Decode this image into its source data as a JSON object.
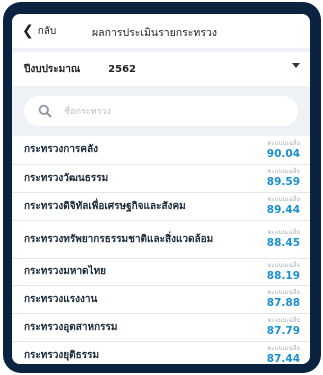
{
  "header": {
    "back_label": "กลับ",
    "title": "ผลการประเมินรายกระทรวง"
  },
  "filter": {
    "label": "ปีงบประมาณ",
    "value": "2562"
  },
  "search": {
    "placeholder": "ชื่อกระทรวง"
  },
  "rows": [
    {
      "name": "กระทรวงการคลัง",
      "caption": "คะแนนเฉลี่ย",
      "score": "90.04"
    },
    {
      "name": "กระทรวงวัฒนธรรม",
      "caption": "คะแนนเฉลี่ย",
      "score": "89.59"
    },
    {
      "name": "กระทรวงดิจิทัลเพื่อเศรษฐกิจและสังคม",
      "caption": "คะแนนเฉลี่ย",
      "score": "89.44"
    },
    {
      "name": "กระทรวงทรัพยากรธรรมชาติและสิ่งแวดล้อม",
      "caption": "คะแนนเฉลี่ย",
      "score": "88.45"
    },
    {
      "name": "กระทรวงมหาดไทย",
      "caption": "คะแนนเฉลี่ย",
      "score": "88.19"
    },
    {
      "name": "กระทรวงแรงงาน",
      "caption": "คะแนนเฉลี่ย",
      "score": "87.88"
    },
    {
      "name": "กระทรวงอุตสาหกรรม",
      "caption": "คะแนนเฉลี่ย",
      "score": "87.79"
    },
    {
      "name": "กระทรวงยุติธรรม",
      "caption": "คะแนนเฉลี่ย",
      "score": "87.44"
    }
  ],
  "colors": {
    "score": "#1a8fd2",
    "frame": "#0b2340",
    "background": "#eef2f6"
  }
}
